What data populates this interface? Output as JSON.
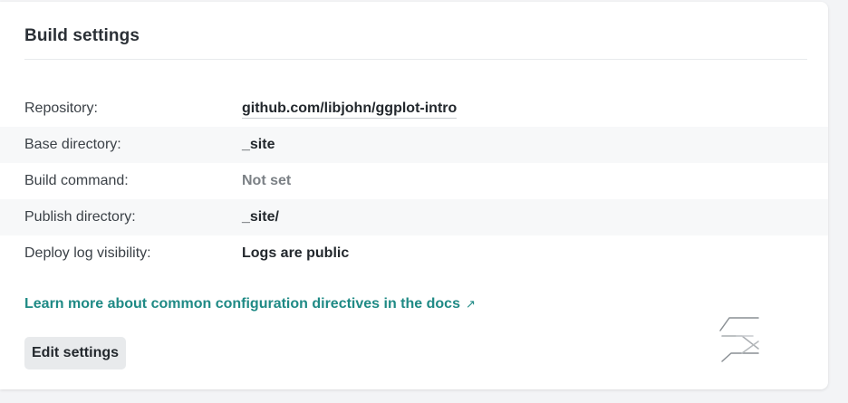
{
  "card": {
    "title": "Build settings"
  },
  "rows": [
    {
      "label": "Repository:",
      "value": "github.com/libjohn/ggplot-intro"
    },
    {
      "label": "Base directory:",
      "value": "_site"
    },
    {
      "label": "Build command:",
      "value": "Not set"
    },
    {
      "label": "Publish directory:",
      "value": "_site/"
    },
    {
      "label": "Deploy log visibility:",
      "value": "Logs are public"
    }
  ],
  "docs_link": {
    "text": "Learn more about common configuration directives in the docs",
    "arrow": "↗"
  },
  "edit_button": {
    "label": "Edit settings"
  },
  "colors": {
    "link": "#1f8a85",
    "muted_value": "#7b8085",
    "alt_row": "#f7f8f9"
  },
  "icons": {
    "external": "external-link-arrow",
    "decoration": "netlify-s-logo-watermark"
  }
}
